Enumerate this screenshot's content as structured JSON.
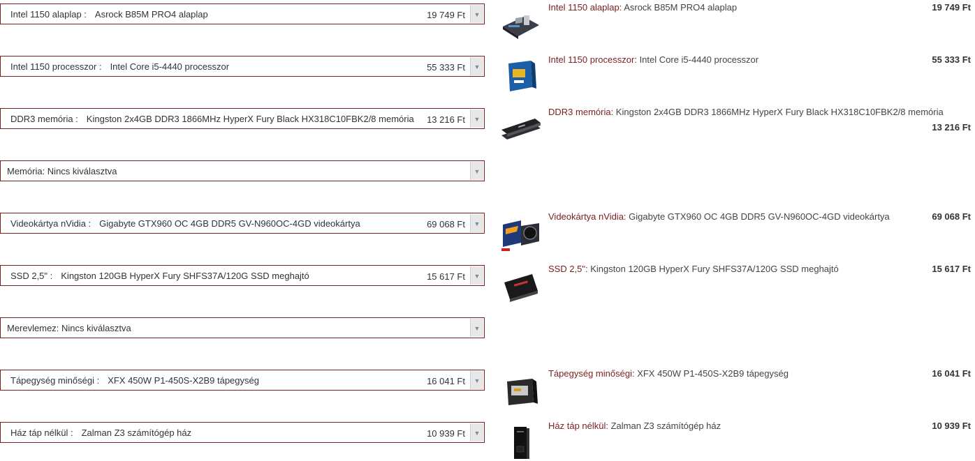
{
  "rows": [
    {
      "category": "Intel 1150 alaplap :",
      "product": "Asrock B85M PRO4 alaplap",
      "price": "19 749 Ft",
      "detail_cat": "Intel 1150 alaplap:",
      "detail_name": " Asrock B85M PRO4 alaplap",
      "icon": "motherboard-icon"
    },
    {
      "category": "Intel 1150 processzor :",
      "product": "Intel Core i5-4440 processzor",
      "price": "55 333 Ft",
      "detail_cat": "Intel 1150 processzor:",
      "detail_name": " Intel Core i5-4440 processzor",
      "icon": "cpu-box-icon"
    },
    {
      "category": "DDR3 memória :",
      "product": "Kingston 2x4GB DDR3 1866MHz HyperX Fury Black HX318C10FBK2/8 memória",
      "price": "13 216 Ft",
      "detail_cat": "DDR3 memória:",
      "detail_name": " Kingston 2x4GB DDR3 1866MHz HyperX Fury Black HX318C10FBK2/8 memória",
      "icon": "ram-icon"
    },
    {
      "empty_label": "Memória: Nincs kiválasztva"
    },
    {
      "category": "Videokártya nVidia :",
      "product": "Gigabyte GTX960 OC 4GB DDR5 GV-N960OC-4GD videokártya",
      "price": "69 068 Ft",
      "detail_cat": "Videokártya nVidia:",
      "detail_name": " Gigabyte GTX960 OC 4GB DDR5 GV-N960OC-4GD videokártya",
      "icon": "gpu-icon"
    },
    {
      "category": "SSD 2,5\" :",
      "product": "Kingston 120GB HyperX Fury SHFS37A/120G SSD meghajtó",
      "price": "15 617 Ft",
      "detail_cat": "SSD 2,5\":",
      "detail_name": " Kingston 120GB HyperX Fury SHFS37A/120G SSD meghajtó",
      "icon": "ssd-icon"
    },
    {
      "empty_label": "Merevlemez: Nincs kiválasztva"
    },
    {
      "category": "Tápegység minőségi :",
      "product": "XFX 450W P1-450S-X2B9 tápegység",
      "price": "16 041 Ft",
      "detail_cat": "Tápegység minőségi:",
      "detail_name": " XFX 450W P1-450S-X2B9 tápegység",
      "icon": "psu-icon"
    },
    {
      "category": "Ház táp nélkül :",
      "product": "Zalman Z3 számítógép ház",
      "price": "10 939 Ft",
      "detail_cat": "Ház táp nélkül:",
      "detail_name": " Zalman Z3 számítógép ház",
      "icon": "pc-case-icon"
    }
  ],
  "colors": {
    "accent": "#7a1f1f",
    "text": "#333333"
  }
}
